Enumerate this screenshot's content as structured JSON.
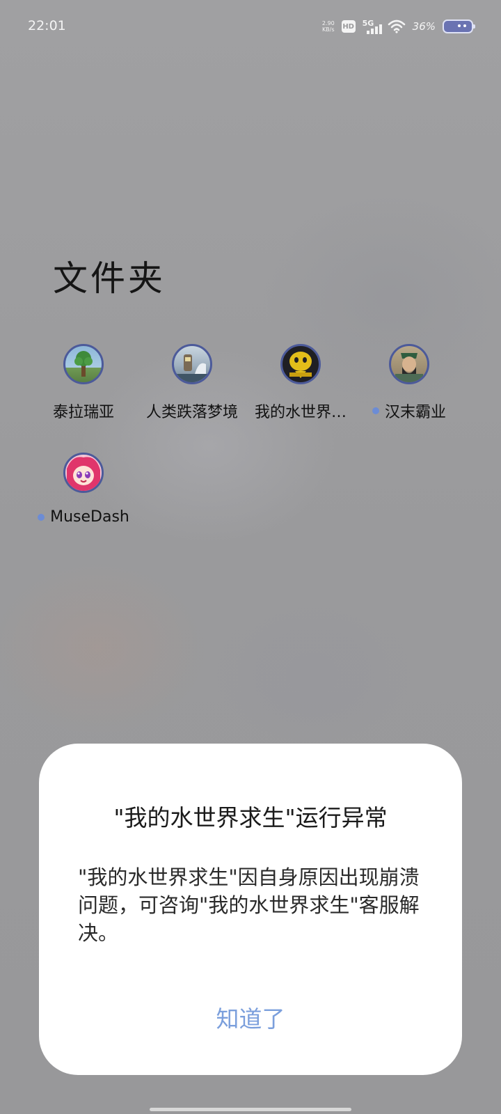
{
  "status_bar": {
    "time": "22:01",
    "net_speed_value": "2.90",
    "net_speed_unit": "KB/s",
    "hd_label": "HD",
    "network_label": "5G",
    "battery_percent": "36%",
    "battery_color": "#6a73b2"
  },
  "folder": {
    "title": "文件夹",
    "apps": [
      {
        "label": "泰拉瑞亚",
        "icon": "terraria-tree-icon",
        "new_badge": false
      },
      {
        "label": "人类跌落梦境",
        "icon": "human-fall-flat-icon",
        "new_badge": false
      },
      {
        "label": "我的水世界…",
        "icon": "water-world-survival-icon",
        "new_badge": false
      },
      {
        "label": "汉末霸业",
        "icon": "han-dynasty-general-icon",
        "new_badge": true
      },
      {
        "label": "MuseDash",
        "icon": "muse-dash-girl-icon",
        "new_badge": true
      }
    ]
  },
  "dialog": {
    "title": "\"我的水世界求生\"运行异常",
    "message": "\"我的水世界求生\"因自身原因出现崩溃问题，可咨询\"我的水世界求生\"客服解决。",
    "confirm_label": "知道了",
    "accent_color": "#7b9fdc"
  }
}
